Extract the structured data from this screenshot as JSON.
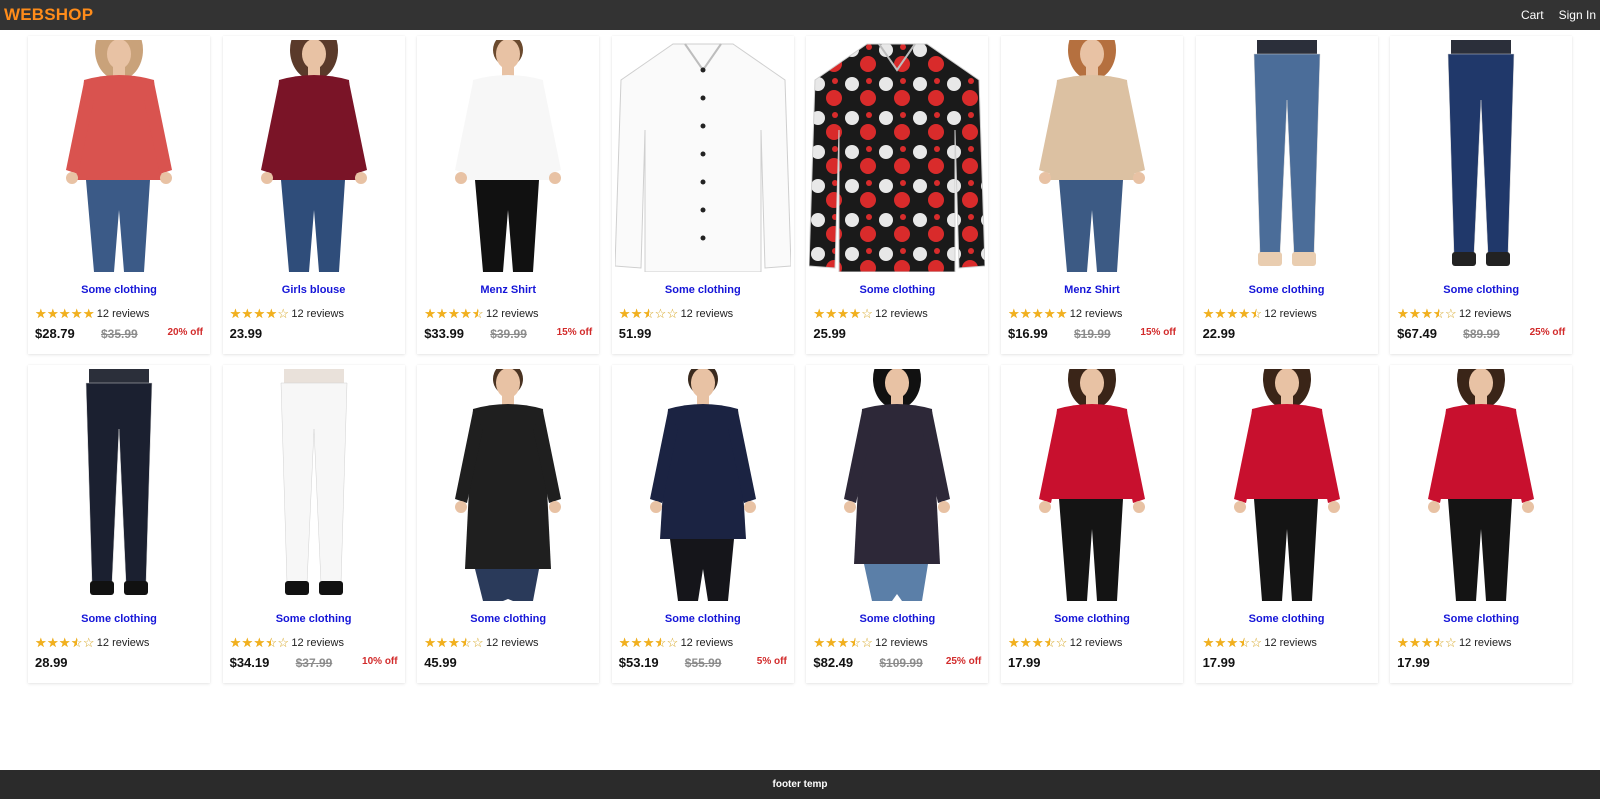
{
  "header": {
    "brand": "WEBSHOP",
    "cart_label": "Cart",
    "signin_label": "Sign In"
  },
  "colors": {
    "header_bg": "#333333",
    "brand": "#ff8c1a",
    "product_link": "#1515d8",
    "discount": "#d22b2b",
    "star": "#f2b01e"
  },
  "products": [
    {
      "name": "Some clothing",
      "stars": 5,
      "reviews": "12 reviews",
      "price": "$28.79",
      "old_price": "$35.99",
      "discount": "20% off",
      "image": "plaid-blouse-model"
    },
    {
      "name": "Girls blouse",
      "stars": 4,
      "reviews": "12 reviews",
      "price": "23.99",
      "old_price": "",
      "discount": "",
      "image": "burgundy-blouse-model"
    },
    {
      "name": "Menz Shirt",
      "stars": 4.5,
      "reviews": "12 reviews",
      "price": "$33.99",
      "old_price": "$39.99",
      "discount": "15% off",
      "image": "white-polo-model"
    },
    {
      "name": "Some clothing",
      "stars": 2.5,
      "reviews": "12 reviews",
      "price": "51.99",
      "old_price": "",
      "discount": "",
      "image": "white-dress-shirt"
    },
    {
      "name": "Some clothing",
      "stars": 4,
      "reviews": "12 reviews",
      "price": "25.99",
      "old_price": "",
      "discount": "",
      "image": "skull-rose-shirt"
    },
    {
      "name": "Menz Shirt",
      "stars": 5,
      "reviews": "12 reviews",
      "price": "$16.99",
      "old_price": "$19.99",
      "discount": "15% off",
      "image": "polka-dot-blouse-model"
    },
    {
      "name": "Some clothing",
      "stars": 4.5,
      "reviews": "12 reviews",
      "price": "22.99",
      "old_price": "",
      "discount": "",
      "image": "skinny-jeans-model"
    },
    {
      "name": "Some clothing",
      "stars": 3.5,
      "reviews": "12 reviews",
      "price": "$67.49",
      "old_price": "$89.99",
      "discount": "25% off",
      "image": "men-jeans-model"
    },
    {
      "name": "Some clothing",
      "stars": 3.5,
      "reviews": "12 reviews",
      "price": "28.99",
      "old_price": "",
      "discount": "",
      "image": "dark-jeans-model"
    },
    {
      "name": "Some clothing",
      "stars": 3.5,
      "reviews": "12 reviews",
      "price": "$34.19",
      "old_price": "$37.99",
      "discount": "10% off",
      "image": "white-jeans-model"
    },
    {
      "name": "Some clothing",
      "stars": 3.5,
      "reviews": "12 reviews",
      "price": "45.99",
      "old_price": "",
      "discount": "",
      "image": "black-peacoat-model"
    },
    {
      "name": "Some clothing",
      "stars": 3.5,
      "reviews": "12 reviews",
      "price": "$53.19",
      "old_price": "$55.99",
      "discount": "5% off",
      "image": "navy-peacoat-model"
    },
    {
      "name": "Some clothing",
      "stars": 3.5,
      "reviews": "12 reviews",
      "price": "$82.49",
      "old_price": "$109.99",
      "discount": "25% off",
      "image": "parka-model"
    },
    {
      "name": "Some clothing",
      "stars": 3.5,
      "reviews": "12 reviews",
      "price": "17.99",
      "old_price": "",
      "discount": "",
      "image": "red-tee-shorts-model"
    },
    {
      "name": "Some clothing",
      "stars": 3.5,
      "reviews": "12 reviews",
      "price": "17.99",
      "old_price": "",
      "discount": "",
      "image": "red-tee-shorts-model"
    },
    {
      "name": "Some clothing",
      "stars": 3.5,
      "reviews": "12 reviews",
      "price": "17.99",
      "old_price": "",
      "discount": "",
      "image": "red-tee-shorts-model"
    }
  ],
  "footer": {
    "text": "footer temp"
  }
}
